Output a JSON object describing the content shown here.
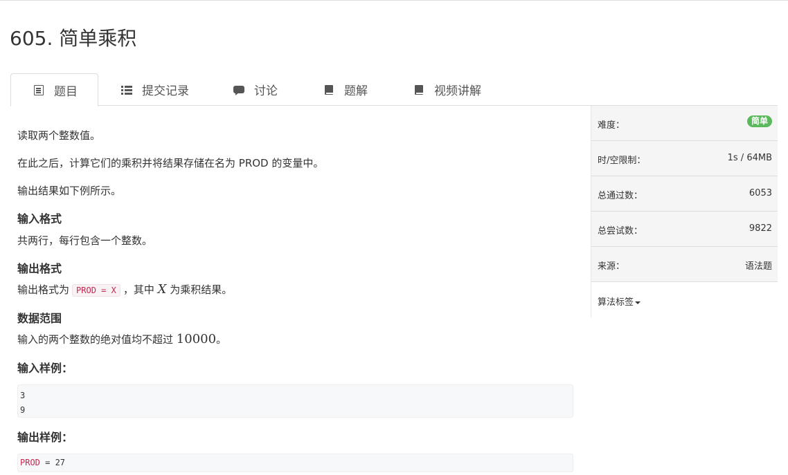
{
  "problem": {
    "title": "605. 简单乘积"
  },
  "tabs": [
    {
      "label": "题目",
      "icon": "list-icon"
    },
    {
      "label": "提交记录",
      "icon": "list-lines-icon"
    },
    {
      "label": "讨论",
      "icon": "comment-icon"
    },
    {
      "label": "题解",
      "icon": "book-icon"
    },
    {
      "label": "视频讲解",
      "icon": "book-icon"
    }
  ],
  "description": {
    "p1": "读取两个整数值。",
    "p2": "在此之后，计算它们的乘积并将结果存储在名为 PROD 的变量中。",
    "p3": "输出结果如下例所示。",
    "input_format_title": "输入格式",
    "input_format_text": "共两行，每行包含一个整数。",
    "output_format_title": "输出格式",
    "output_format_prefix": "输出格式为",
    "output_format_code": "PROD = X",
    "output_format_mid": "，其中",
    "output_format_var": "X",
    "output_format_suffix": "为乘积结果。",
    "range_title": "数据范围",
    "range_prefix": "输入的两个整数的绝对值均不超过",
    "range_value": "10000",
    "range_suffix": "。",
    "sample_input_title": "输入样例：",
    "sample_input_lines": [
      "3",
      "9"
    ],
    "sample_output_title": "输出样例：",
    "sample_output_keyword": "PROD",
    "sample_output_rest": " = 27"
  },
  "sidebar": {
    "difficulty_label": "难度：",
    "difficulty_value": "简单",
    "difficulty_color": "#5cb85c",
    "limit_label": "时/空限制：",
    "limit_value": "1s / 64MB",
    "accepted_label": "总通过数：",
    "accepted_value": "6053",
    "attempts_label": "总尝试数：",
    "attempts_value": "9822",
    "source_label": "来源：",
    "source_value": "语法题",
    "tags_label": "算法标签"
  }
}
